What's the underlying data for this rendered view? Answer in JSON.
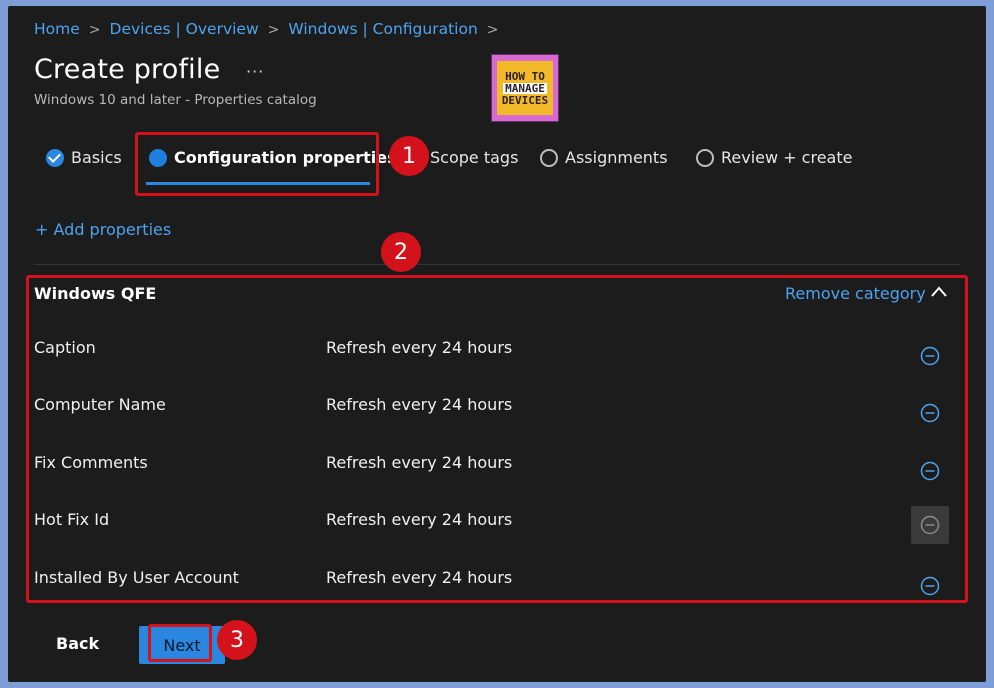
{
  "breadcrumb": {
    "items": [
      "Home",
      "Devices | Overview",
      "Windows | Configuration"
    ],
    "separator": ">"
  },
  "page": {
    "title": "Create profile",
    "more_label": "···",
    "subtitle": "Windows 10 and later - Properties catalog"
  },
  "logo": {
    "line1": "HOW TO",
    "line2": "MANAGE",
    "line3": "DEVICES"
  },
  "wizard": {
    "steps": [
      {
        "label": "Basics",
        "state": "done"
      },
      {
        "label": "Configuration properties",
        "state": "current"
      },
      {
        "label": "Scope tags",
        "state": "todo"
      },
      {
        "label": "Assignments",
        "state": "todo"
      },
      {
        "label": "Review + create",
        "state": "todo"
      }
    ]
  },
  "add_properties_label": "+ Add properties",
  "category": {
    "title": "Windows QFE",
    "remove_label": "Remove category",
    "rows": [
      {
        "name": "Caption",
        "value": "Refresh every 24 hours"
      },
      {
        "name": "Computer Name",
        "value": "Refresh every 24 hours"
      },
      {
        "name": "Fix Comments",
        "value": "Refresh every 24 hours"
      },
      {
        "name": "Hot Fix Id",
        "value": "Refresh every 24 hours"
      },
      {
        "name": "Installed By User Account",
        "value": "Refresh every 24 hours"
      }
    ]
  },
  "footer": {
    "back_label": "Back",
    "next_label": "Next"
  },
  "annotations": [
    "1",
    "2",
    "3"
  ],
  "colors": {
    "accent": "#2a86de",
    "link": "#4da3ee",
    "annotation_red": "#d4121c",
    "background": "#1c1c1c",
    "outer_border": "#7f9ed8"
  }
}
